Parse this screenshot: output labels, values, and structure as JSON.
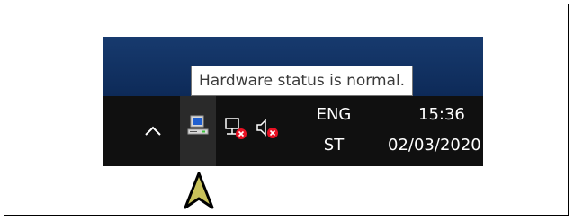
{
  "tooltip": {
    "text": "Hardware status is normal."
  },
  "tray": {
    "show_hidden_icon": "chevron-up-icon",
    "hardware_icon": "computer-monitor-icon",
    "network_icon": "network-disconnected-icon",
    "volume_icon": "volume-muted-icon",
    "language": {
      "line1": "ENG",
      "line2": "ST"
    },
    "clock": {
      "time": "15:36",
      "date": "02/03/2020"
    }
  },
  "colors": {
    "taskbar": "#101010",
    "desktop": "#173a6e",
    "highlight": "#2a2a2a",
    "error_badge": "#e81123",
    "arrow_fill": "#c9c25a"
  }
}
